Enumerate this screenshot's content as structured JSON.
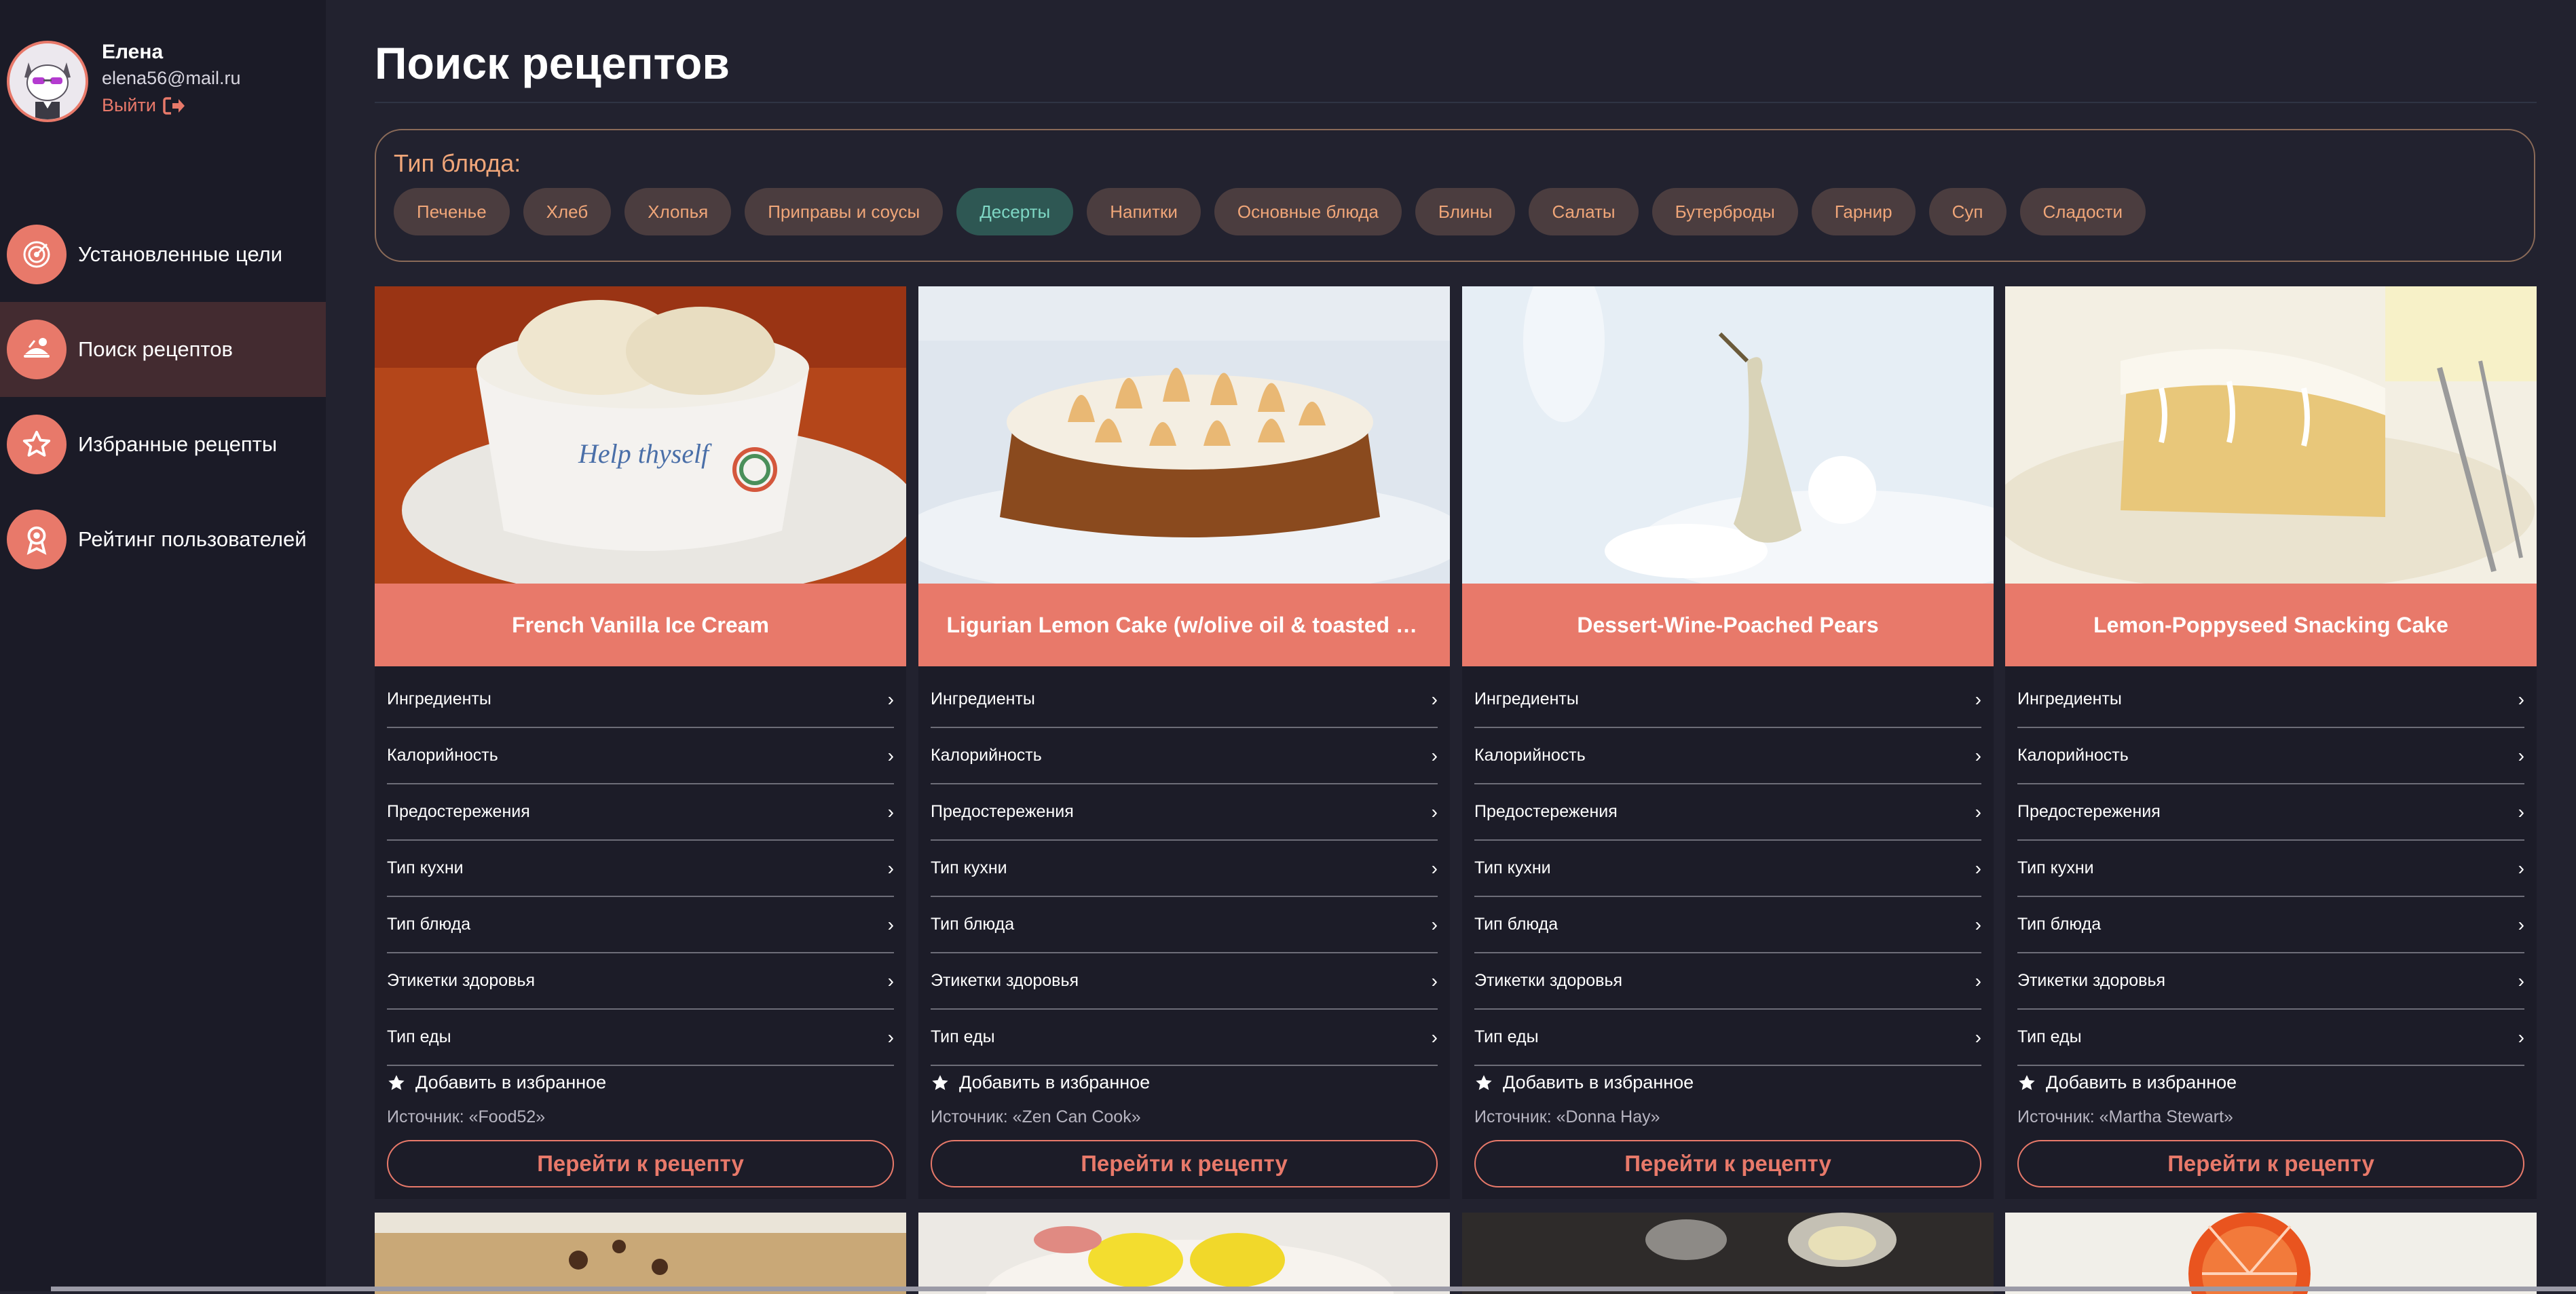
{
  "user": {
    "name": "Елена",
    "email": "elena56@mail.ru",
    "logout": "Выйти"
  },
  "nav": [
    {
      "label": "Установленные цели",
      "icon": "target-icon",
      "active": false
    },
    {
      "label": "Поиск рецептов",
      "icon": "chef-icon",
      "active": true
    },
    {
      "label": "Избранные рецепты",
      "icon": "star-icon",
      "active": false
    },
    {
      "label": "Рейтинг пользователей",
      "icon": "award-icon",
      "active": false
    }
  ],
  "page": {
    "title": "Поиск рецептов"
  },
  "filter": {
    "title": "Тип блюда:",
    "chips": [
      "Печенье",
      "Хлеб",
      "Хлопья",
      "Приправы и соусы",
      "Десерты",
      "Напитки",
      "Основные блюда",
      "Блины",
      "Салаты",
      "Бутерброды",
      "Гарнир",
      "Суп",
      "Сладости"
    ],
    "active": "Десерты"
  },
  "card_common": {
    "rows": [
      "Ингредиенты",
      "Калорийность",
      "Предостережения",
      "Тип кухни",
      "Тип блюда",
      "Этикетки здоровья",
      "Тип еды"
    ],
    "favorite": "Добавить в избранное",
    "button": "Перейти к рецепту"
  },
  "recipes": [
    {
      "title": "French Vanilla Ice Cream",
      "source": "Источник: «Food52»"
    },
    {
      "title": "Ligurian Lemon Cake (w/olive oil & toasted meri...",
      "source": "Источник: «Zen Can Cook»"
    },
    {
      "title": "Dessert-Wine-Poached Pears",
      "source": "Источник: «Donna Hay»"
    },
    {
      "title": "Lemon-Poppyseed Snacking Cake",
      "source": "Источник: «Martha Stewart»"
    }
  ],
  "colors": {
    "accent": "#e8796a",
    "bg": "#22222f",
    "sidebar": "#1b1b27",
    "chip": "#4b3d3f",
    "chip_active": "#2e5753"
  }
}
